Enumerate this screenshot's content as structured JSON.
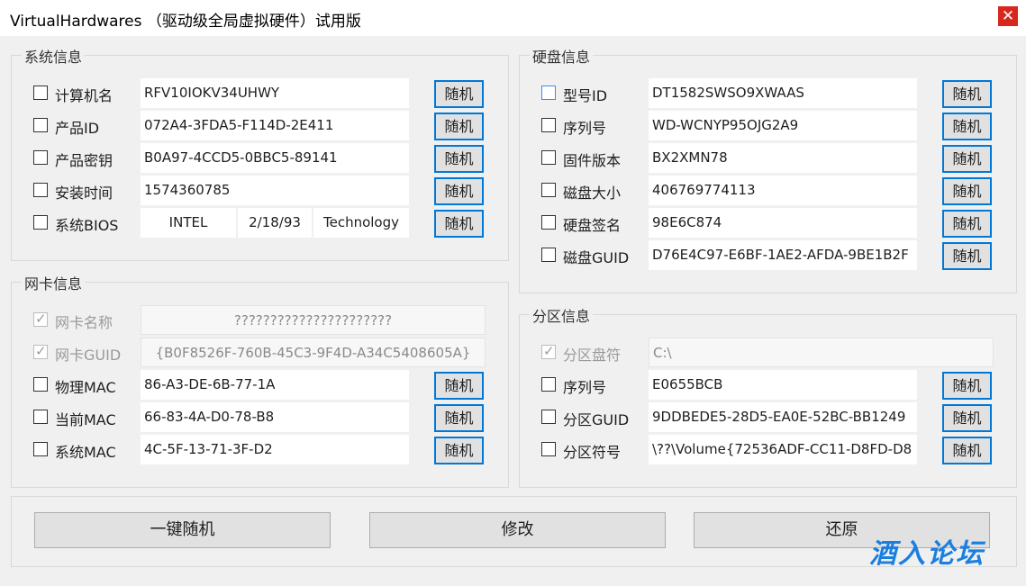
{
  "window": {
    "title": "VirtualHardwares （驱动级全局虚拟硬件）试用版",
    "close_glyph": "✕"
  },
  "random_label": "随机",
  "system": {
    "title": "系统信息",
    "rows": [
      {
        "label": "计算机名",
        "value": "RFV10IOKV34UHWY"
      },
      {
        "label": "产品ID",
        "value": "072A4-3FDA5-F114D-2E411"
      },
      {
        "label": "产品密钥",
        "value": "B0A97-4CCD5-0BBC5-89141"
      },
      {
        "label": "安装时间",
        "value": "1574360785"
      }
    ],
    "bios": {
      "label": "系统BIOS",
      "vendor": "INTEL",
      "date": "2/18/93",
      "desc": "Technology"
    }
  },
  "nic": {
    "title": "网卡信息",
    "name": {
      "label": "网卡名称",
      "value": "??????????????????????"
    },
    "guid": {
      "label": "网卡GUID",
      "value": "{B0F8526F-760B-45C3-9F4D-A34C5408605A}"
    },
    "rows": [
      {
        "label": "物理MAC",
        "value": "86-A3-DE-6B-77-1A"
      },
      {
        "label": "当前MAC",
        "value": "66-83-4A-D0-78-B8"
      },
      {
        "label": "系统MAC",
        "value": "4C-5F-13-71-3F-D2"
      }
    ]
  },
  "disk": {
    "title": "硬盘信息",
    "rows": [
      {
        "label": "型号ID",
        "value": "DT1582SWSO9XWAAS"
      },
      {
        "label": "序列号",
        "value": "WD-WCNYP95OJG2A9"
      },
      {
        "label": "固件版本",
        "value": "BX2XMN78"
      },
      {
        "label": "磁盘大小",
        "value": "406769774113"
      },
      {
        "label": "硬盘签名",
        "value": "98E6C874"
      },
      {
        "label": "磁盘GUID",
        "value": "D76E4C97-E6BF-1AE2-AFDA-9BE1B2F"
      }
    ]
  },
  "partition": {
    "title": "分区信息",
    "drive": {
      "label": "分区盘符",
      "value": "C:\\"
    },
    "rows": [
      {
        "label": "序列号",
        "value": "E0655BCB"
      },
      {
        "label": "分区GUID",
        "value": "9DDBEDE5-28D5-EA0E-52BC-BB1249"
      },
      {
        "label": "分区符号",
        "value": "\\??\\Volume{72536ADF-CC11-D8FD-D8"
      }
    ]
  },
  "actions": {
    "randomize_all": "一键随机",
    "modify": "修改",
    "restore": "还原"
  },
  "watermark": "酒入论坛",
  "colors": {
    "accent": "#0078d7",
    "close": "#d7281e",
    "watermark": "#1a7fe0"
  }
}
